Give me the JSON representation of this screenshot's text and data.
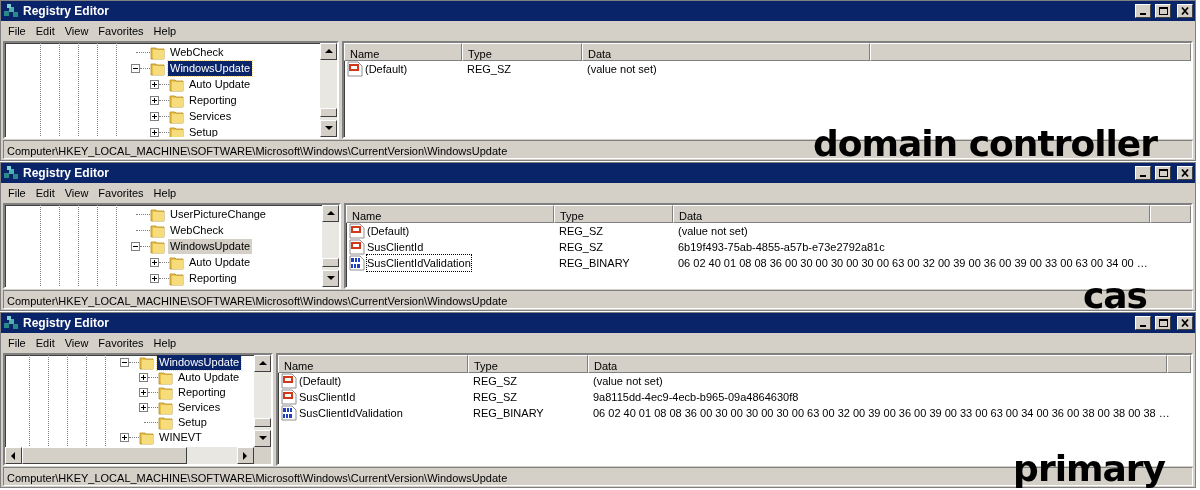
{
  "windows": [
    {
      "title": "Registry Editor",
      "menu": [
        "File",
        "Edit",
        "View",
        "Favorites",
        "Help"
      ],
      "tree_focused": true,
      "tree": [
        {
          "label": "WebCheck",
          "expandable": false,
          "selected": false
        },
        {
          "label": "WindowsUpdate",
          "expandable": true,
          "expanded": true,
          "selected": true,
          "children": [
            {
              "label": "Auto Update",
              "expandable": true,
              "expanded": false,
              "selected": false
            },
            {
              "label": "Reporting",
              "expandable": true,
              "expanded": false,
              "selected": false
            },
            {
              "label": "Services",
              "expandable": true,
              "expanded": false,
              "selected": false
            },
            {
              "label": "Setup",
              "expandable": true,
              "expanded": false,
              "selected": false
            }
          ]
        }
      ],
      "columns": [
        "Name",
        "Type",
        "Data"
      ],
      "rows": [
        {
          "kind": "string",
          "name": "(Default)",
          "type": "REG_SZ",
          "data": "(value not set)",
          "focused": false
        }
      ],
      "path": "Computer\\HKEY_LOCAL_MACHINE\\SOFTWARE\\Microsoft\\Windows\\CurrentVersion\\WindowsUpdate",
      "annotation": "domain controller"
    },
    {
      "title": "Registry Editor",
      "menu": [
        "File",
        "Edit",
        "View",
        "Favorites",
        "Help"
      ],
      "tree_focused": false,
      "tree": [
        {
          "label": "UserPictureChange",
          "expandable": false,
          "selected": false
        },
        {
          "label": "WebCheck",
          "expandable": false,
          "selected": false
        },
        {
          "label": "WindowsUpdate",
          "expandable": true,
          "expanded": true,
          "selected": true,
          "children": [
            {
              "label": "Auto Update",
              "expandable": true,
              "expanded": false,
              "selected": false
            },
            {
              "label": "Reporting",
              "expandable": true,
              "expanded": false,
              "selected": false
            }
          ]
        }
      ],
      "columns": [
        "Name",
        "Type",
        "Data"
      ],
      "rows": [
        {
          "kind": "string",
          "name": "(Default)",
          "type": "REG_SZ",
          "data": "(value not set)",
          "focused": false
        },
        {
          "kind": "string",
          "name": "SusClientId",
          "type": "REG_SZ",
          "data": "6b19f493-75ab-4855-a57b-e73e2792a81c",
          "focused": false
        },
        {
          "kind": "binary",
          "name": "SusClientIdValidation",
          "type": "REG_BINARY",
          "data": "06 02 40 01 08 08 36 00 30 00 30 00 30 00 63 00 32 00 39 00 36 00 39 00 33 00 63 00 34 00 …",
          "focused": true
        }
      ],
      "path": "Computer\\HKEY_LOCAL_MACHINE\\SOFTWARE\\Microsoft\\Windows\\CurrentVersion\\WindowsUpdate",
      "annotation": "cas"
    },
    {
      "title": "Registry Editor",
      "menu": [
        "File",
        "Edit",
        "View",
        "Favorites",
        "Help"
      ],
      "tree_focused": true,
      "horizontal_scrollbar": true,
      "tree": [
        {
          "label": "WindowsUpdate",
          "expandable": true,
          "expanded": true,
          "selected": true,
          "children": [
            {
              "label": "Auto Update",
              "expandable": true,
              "expanded": false,
              "selected": false
            },
            {
              "label": "Reporting",
              "expandable": true,
              "expanded": false,
              "selected": false
            },
            {
              "label": "Services",
              "expandable": true,
              "expanded": false,
              "selected": false
            },
            {
              "label": "Setup",
              "expandable": false,
              "selected": false
            }
          ]
        },
        {
          "label": "WINEVT",
          "expandable": true,
          "expanded": false,
          "selected": false
        }
      ],
      "columns": [
        "Name",
        "Type",
        "Data"
      ],
      "rows": [
        {
          "kind": "string",
          "name": "(Default)",
          "type": "REG_SZ",
          "data": "(value not set)",
          "focused": false
        },
        {
          "kind": "string",
          "name": "SusClientId",
          "type": "REG_SZ",
          "data": "9a8115dd-4ec9-4ecb-b965-09a4864630f8",
          "focused": false
        },
        {
          "kind": "binary",
          "name": "SusClientIdValidation",
          "type": "REG_BINARY",
          "data": "06 02 40 01 08 08 36 00 30 00 30 00 30 00 63 00 32 00 39 00 36 00 39 00 33 00 63 00 34 00 36 00 38 00 38 00 38 …",
          "focused": false
        }
      ],
      "path": "Computer\\HKEY_LOCAL_MACHINE\\SOFTWARE\\Microsoft\\Windows\\CurrentVersion\\WindowsUpdate",
      "annotation": "primary"
    }
  ]
}
